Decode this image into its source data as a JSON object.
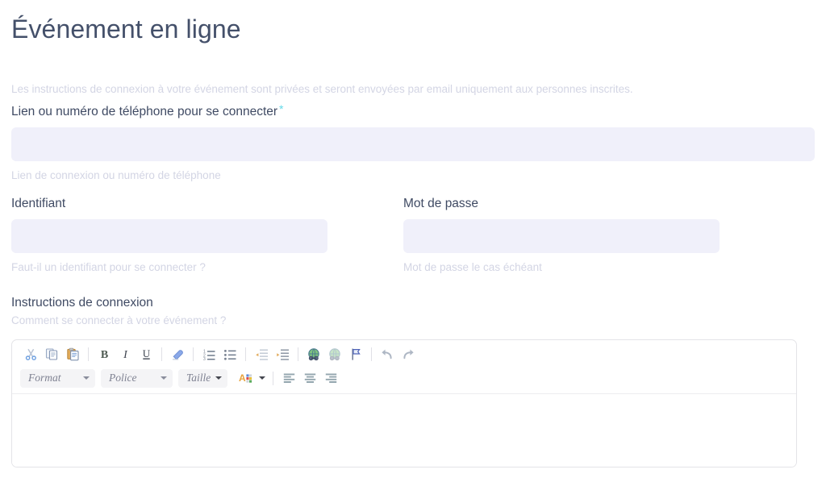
{
  "page": {
    "title": "Événement en ligne",
    "intro_note": "Les instructions de connexion à votre événement sont privées et seront envoyées par email uniquement aux personnes inscrites."
  },
  "colors": {
    "heading": "#44506a",
    "label": "#3f4a63",
    "hint": "#d3d5e4",
    "input_bg": "#f0f0fa",
    "required_star": "#63d9e8",
    "editor_border": "#e4e4e8"
  },
  "fields": {
    "connection_link": {
      "label": "Lien ou numéro de téléphone pour se connecter",
      "required_marker": "*",
      "value": "",
      "placeholder": "",
      "hint": "Lien de connexion ou numéro de téléphone"
    },
    "identifier": {
      "label": "Identifiant",
      "value": "",
      "placeholder": "",
      "hint": "Faut-il un identifiant pour se connecter ?"
    },
    "password": {
      "label": "Mot de passe",
      "value": "",
      "placeholder": "",
      "hint": "Mot de passe le cas échéant"
    },
    "instructions": {
      "label": "Instructions de connexion",
      "hint": "Comment se connecter à votre événement ?",
      "body_value": ""
    }
  },
  "editor": {
    "toolbar_row1": [
      {
        "name": "cut-icon",
        "label": "Couper"
      },
      {
        "name": "copy-icon",
        "label": "Copier"
      },
      {
        "name": "paste-icon",
        "label": "Coller"
      },
      {
        "name": "separator",
        "label": ""
      },
      {
        "name": "bold-icon",
        "label": "B"
      },
      {
        "name": "italic-icon",
        "label": "I"
      },
      {
        "name": "underline-icon",
        "label": "U"
      },
      {
        "name": "separator",
        "label": ""
      },
      {
        "name": "remove-format-icon",
        "label": "Supprimer le format"
      },
      {
        "name": "separator",
        "label": ""
      },
      {
        "name": "numbered-list-icon",
        "label": "Liste numérotée"
      },
      {
        "name": "bulleted-list-icon",
        "label": "Liste à puces"
      },
      {
        "name": "separator",
        "label": ""
      },
      {
        "name": "outdent-icon",
        "label": "Diminuer le retrait"
      },
      {
        "name": "indent-icon",
        "label": "Augmenter le retrait"
      },
      {
        "name": "separator",
        "label": ""
      },
      {
        "name": "link-icon",
        "label": "Lien"
      },
      {
        "name": "unlink-icon",
        "label": "Supprimer le lien"
      },
      {
        "name": "anchor-icon",
        "label": "Ancre"
      },
      {
        "name": "separator",
        "label": ""
      },
      {
        "name": "undo-icon",
        "label": "Annuler"
      },
      {
        "name": "redo-icon",
        "label": "Rétablir"
      }
    ],
    "toolbar_row2": {
      "format_select": "Format",
      "font_select": "Police",
      "size_select": "Taille",
      "text_color": "A",
      "align_left": "Aligner à gauche",
      "align_center": "Centrer",
      "align_right": "Aligner à droite"
    }
  }
}
